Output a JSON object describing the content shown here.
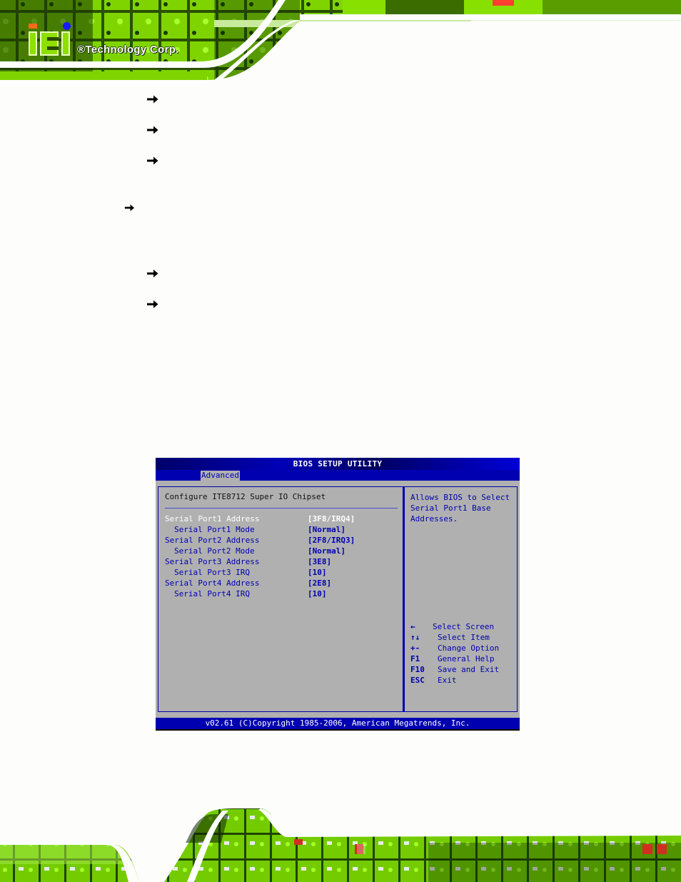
{
  "header": {
    "brand": "iEi",
    "tagline": "®Technology Corp.",
    "colors": {
      "pcb_green": "#8ee000",
      "pcb_dark": "#1a3a00",
      "logo_orange": "#ff6a1a",
      "logo_blue": "#1a1aff"
    }
  },
  "bullets": {
    "icon": "arrow-right-icon",
    "count_indented": 5,
    "count_outdented": 1
  },
  "bios": {
    "title": "BIOS SETUP UTILITY",
    "active_tab": "Advanced",
    "heading": "Configure ITE8712 Super IO Chipset",
    "settings": [
      {
        "label": "Serial Port1 Address",
        "value": "[3F8/IRQ4]",
        "sub": false,
        "selected": true
      },
      {
        "label": "Serial Port1 Mode",
        "value": "[Normal]",
        "sub": true,
        "selected": false
      },
      {
        "label": "Serial Port2 Address",
        "value": "[2F8/IRQ3]",
        "sub": false,
        "selected": false
      },
      {
        "label": "Serial Port2 Mode",
        "value": "[Normal]",
        "sub": true,
        "selected": false
      },
      {
        "label": "Serial Port3 Address",
        "value": "[3E8]",
        "sub": false,
        "selected": false
      },
      {
        "label": "Serial Port3 IRQ",
        "value": "[10]",
        "sub": true,
        "selected": false
      },
      {
        "label": "Serial Port4 Address",
        "value": "[2E8]",
        "sub": false,
        "selected": false
      },
      {
        "label": "Serial Port4 IRQ",
        "value": "[10]",
        "sub": true,
        "selected": false
      }
    ],
    "help": [
      "Allows BIOS to Select",
      "Serial Port1 Base",
      "Addresses."
    ],
    "keys": [
      {
        "key": "←",
        "desc": "Select Screen"
      },
      {
        "key": "↑↓",
        "desc": "Select Item"
      },
      {
        "key": "+-",
        "desc": "Change Option"
      },
      {
        "key": "F1",
        "desc": "General Help"
      },
      {
        "key": "F10",
        "desc": "Save and Exit"
      },
      {
        "key": "ESC",
        "desc": "Exit"
      }
    ],
    "footer": "v02.61 (C)Copyright 1985-2006, American Megatrends, Inc.",
    "colors": {
      "blue": "#0000b0",
      "gray": "#b0b0b0",
      "selected_text": "#ffffff"
    }
  }
}
